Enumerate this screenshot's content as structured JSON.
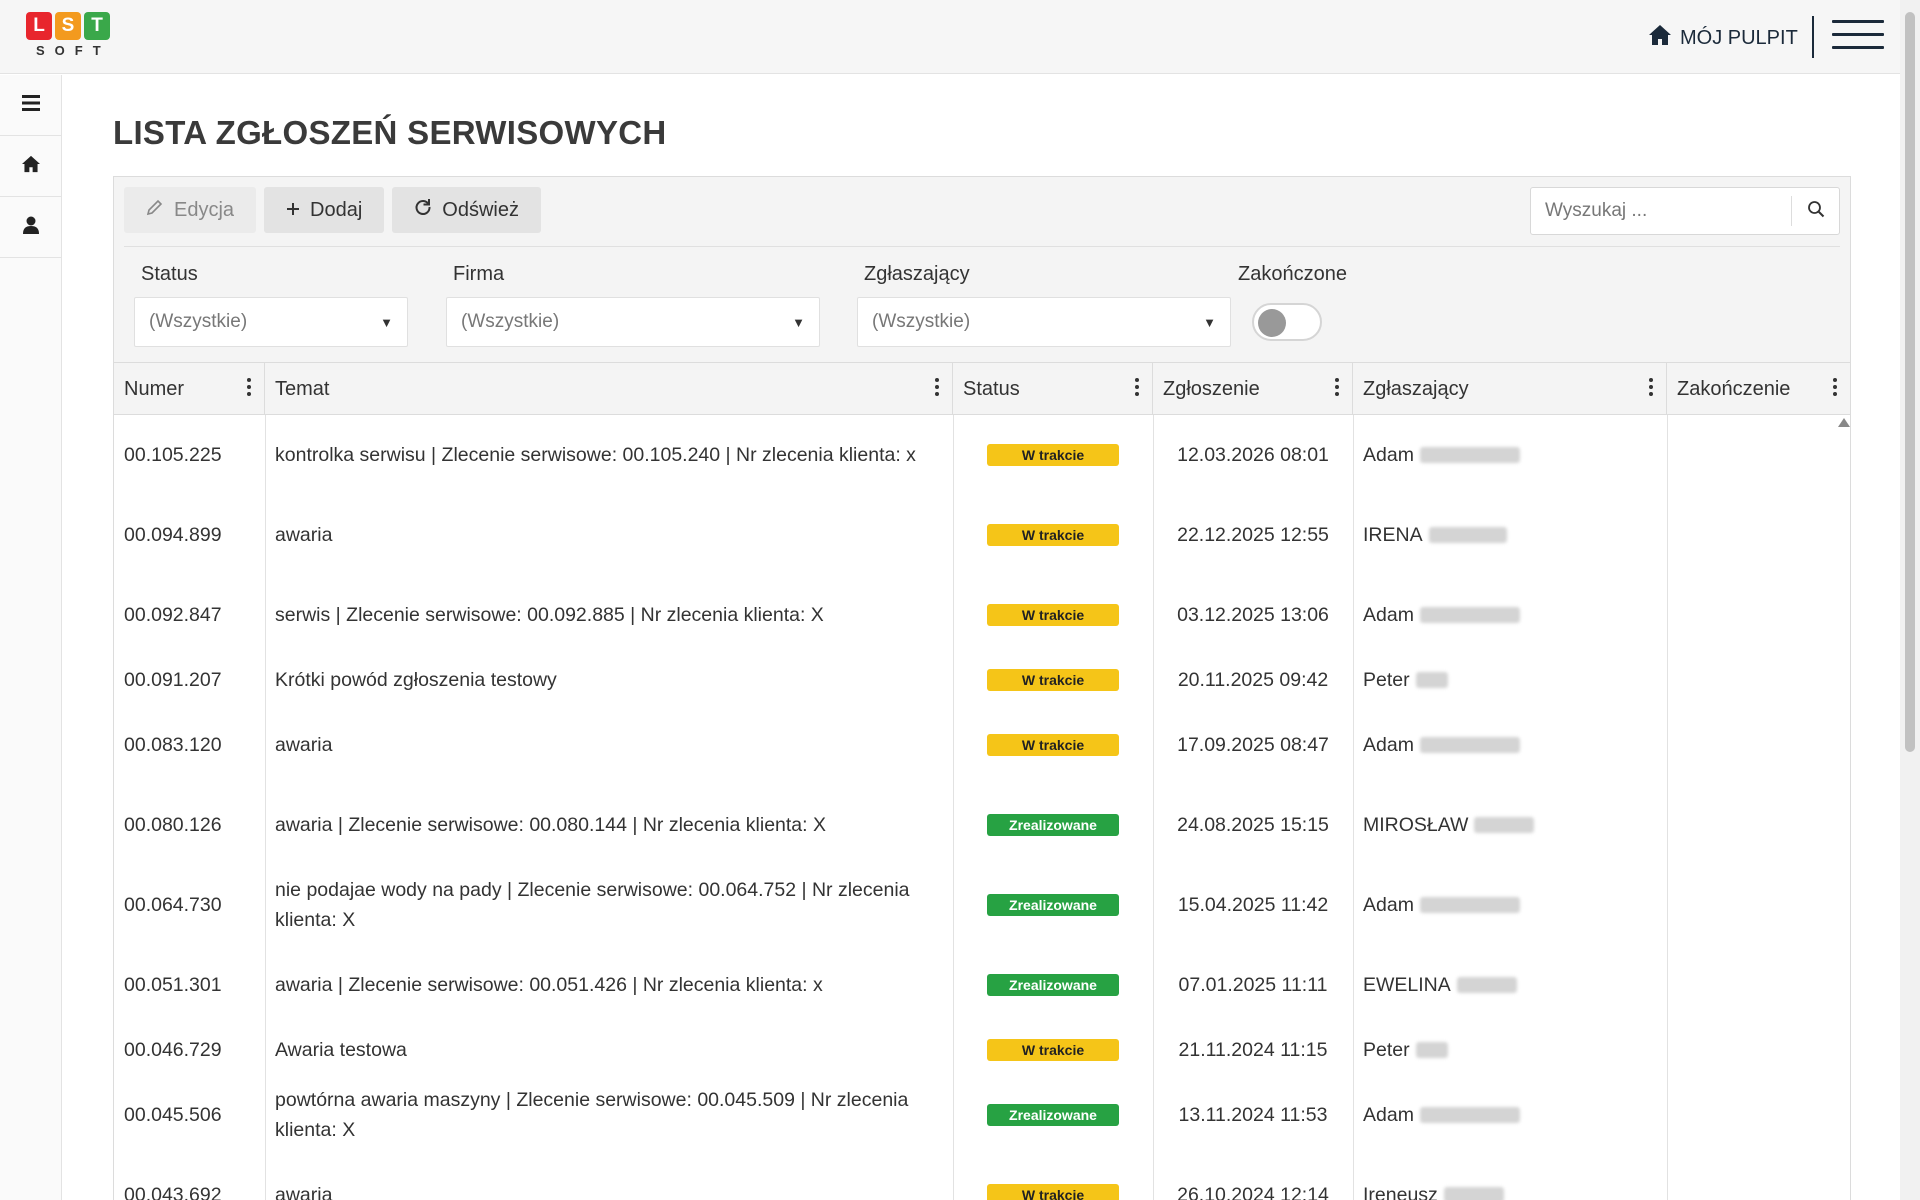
{
  "brand": {
    "letters": [
      "L",
      "S",
      "T"
    ],
    "colors": [
      "#e8262d",
      "#f39a1e",
      "#3aa84a"
    ],
    "sub": "SOFT"
  },
  "topbar": {
    "dashboard_label": "MÓJ PULPIT",
    "dashboard_icon": "home-icon",
    "menu_icon": "hamburger-icon"
  },
  "sidebar": {
    "items": [
      {
        "icon": "menu-icon"
      },
      {
        "icon": "home-icon"
      },
      {
        "icon": "user-icon"
      }
    ]
  },
  "page": {
    "title": "LISTA ZGŁOSZEŃ SERWISOWYCH"
  },
  "toolbar": {
    "edit_label": "Edycja",
    "add_label": "Dodaj",
    "refresh_label": "Odśwież",
    "search_placeholder": "Wyszukaj ..."
  },
  "filters": {
    "status_label": "Status",
    "status_value": "(Wszystkie)",
    "company_label": "Firma",
    "company_value": "(Wszystkie)",
    "reporter_label": "Zgłaszający",
    "reporter_value": "(Wszystkie)",
    "finished_label": "Zakończone",
    "finished_on": false
  },
  "table": {
    "columns": [
      "Numer",
      "Temat",
      "Status",
      "Zgłoszenie",
      "Zgłaszający",
      "Zakończenie"
    ],
    "rows": [
      {
        "number": "00.105.225",
        "topic": "kontrolka serwisu | Zlecenie serwisowe: 00.105.240 | Nr zlecenia klienta: x",
        "status": "W trakcie",
        "kind": "progress",
        "date": "12.03.2026 08:01",
        "reporter": "Adam"
      },
      {
        "number": "00.094.899",
        "topic": "awaria",
        "status": "W trakcie",
        "kind": "progress",
        "date": "22.12.2025 12:55",
        "reporter": "IRENA"
      },
      {
        "number": "00.092.847",
        "topic": "serwis | Zlecenie serwisowe: 00.092.885 | Nr zlecenia klienta: X",
        "status": "W trakcie",
        "kind": "progress",
        "date": "03.12.2025 13:06",
        "reporter": "Adam"
      },
      {
        "number": "00.091.207",
        "topic": "Krótki powód zgłoszenia testowy",
        "status": "W trakcie",
        "kind": "progress",
        "date": "20.11.2025 09:42",
        "reporter": "Peter"
      },
      {
        "number": "00.083.120",
        "topic": "awaria",
        "status": "W trakcie",
        "kind": "progress",
        "date": "17.09.2025 08:47",
        "reporter": "Adam"
      },
      {
        "number": "00.080.126",
        "topic": "awaria | Zlecenie serwisowe: 00.080.144 | Nr zlecenia klienta: X",
        "status": "Zrealizowane",
        "kind": "done",
        "date": "24.08.2025 15:15",
        "reporter": "MIROSŁAW"
      },
      {
        "number": "00.064.730",
        "topic": "nie podajae wody na pady | Zlecenie serwisowe: 00.064.752 | Nr zlecenia klienta: X",
        "status": "Zrealizowane",
        "kind": "done",
        "date": "15.04.2025 11:42",
        "reporter": "Adam"
      },
      {
        "number": "00.051.301",
        "topic": "awaria | Zlecenie serwisowe: 00.051.426 | Nr zlecenia klienta: x",
        "status": "Zrealizowane",
        "kind": "done",
        "date": "07.01.2025 11:11",
        "reporter": "EWELINA"
      },
      {
        "number": "00.046.729",
        "topic": "Awaria testowa",
        "status": "W trakcie",
        "kind": "progress",
        "date": "21.11.2024 11:15",
        "reporter": "Peter"
      },
      {
        "number": "00.045.506",
        "topic": "powtórna awaria maszyny | Zlecenie serwisowe: 00.045.509 | Nr zlecenia klienta: X",
        "status": "Zrealizowane",
        "kind": "done",
        "date": "13.11.2024 11:53",
        "reporter": "Adam"
      },
      {
        "number": "00.043.692",
        "topic": "awaria",
        "status": "W trakcie",
        "kind": "progress",
        "date": "26.10.2024 12:14",
        "reporter": "Ireneusz"
      }
    ]
  }
}
